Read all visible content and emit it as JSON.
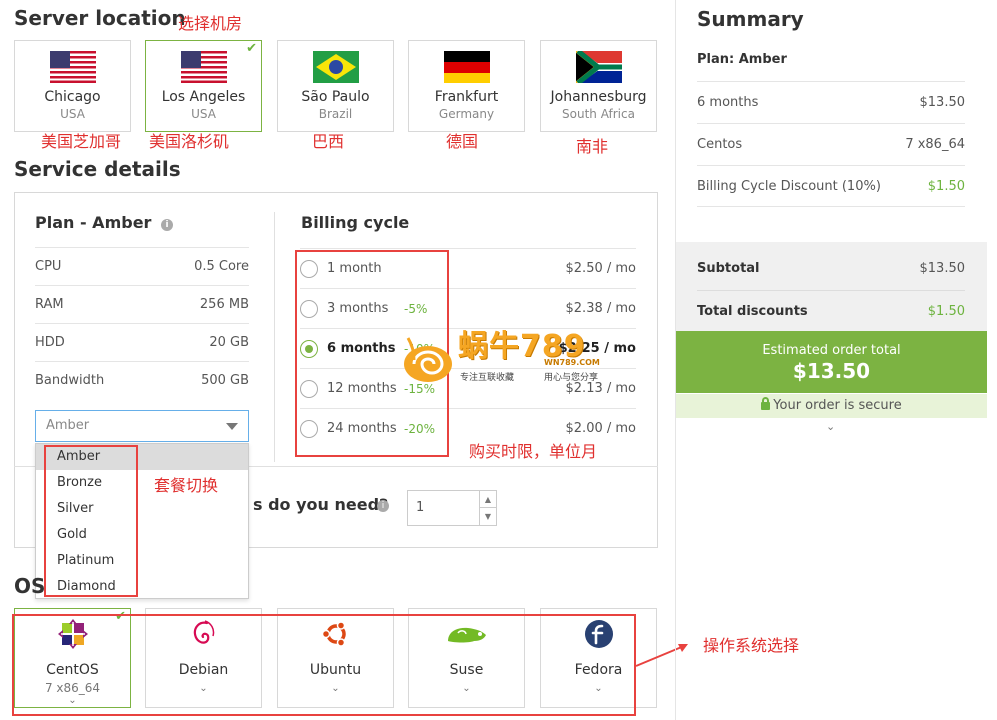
{
  "server_location": {
    "title": "Server location",
    "annotation": "选择机房",
    "locations": [
      {
        "city": "Chicago",
        "country": "USA",
        "flag": "us-flag",
        "note": "美国芝加哥",
        "selected": false
      },
      {
        "city": "Los Angeles",
        "country": "USA",
        "flag": "us-flag",
        "note": "美国洛杉矶",
        "selected": true
      },
      {
        "city": "São Paulo",
        "country": "Brazil",
        "flag": "brazil-flag",
        "note": "巴西",
        "selected": false
      },
      {
        "city": "Frankfurt",
        "country": "Germany",
        "flag": "germany-flag",
        "note": "德国",
        "selected": false
      },
      {
        "city": "Johannesburg",
        "country": "South Africa",
        "flag": "south-africa-flag",
        "note": "南非",
        "selected": false
      }
    ]
  },
  "service_details": {
    "title": "Service details",
    "plan_title": "Plan - Amber",
    "specs": [
      {
        "label": "CPU",
        "value": "0.5 Core"
      },
      {
        "label": "RAM",
        "value": "256 MB"
      },
      {
        "label": "HDD",
        "value": "20 GB"
      },
      {
        "label": "Bandwidth",
        "value": "500 GB"
      }
    ],
    "plan_select_value": "Amber",
    "plan_options": [
      "Amber",
      "Bronze",
      "Silver",
      "Gold",
      "Platinum",
      "Diamond"
    ],
    "plan_annotation": "套餐切换",
    "billing_title": "Billing cycle",
    "billing": [
      {
        "label": "1 month",
        "discount": "",
        "price": "$2.50 / mo",
        "selected": false
      },
      {
        "label": "3 months",
        "discount": "-5%",
        "price": "$2.38 / mo",
        "selected": false
      },
      {
        "label": "6 months",
        "discount": "-10%",
        "price": "$2.25 / mo",
        "selected": true
      },
      {
        "label": "12 months",
        "discount": "-15%",
        "price": "$2.13 / mo",
        "selected": false
      },
      {
        "label": "24 months",
        "discount": "-20%",
        "price": "$2.00 / mo",
        "selected": false
      }
    ],
    "billing_annotation": "购买时限，单位月",
    "quantity_question": "s do you need?",
    "quantity_value": "1"
  },
  "os": {
    "title": "OS",
    "annotation": "操作系统选择",
    "items": [
      {
        "name": "CentOS",
        "version": "7 x86_64",
        "icon": "centos-icon",
        "selected": true
      },
      {
        "name": "Debian",
        "version": "",
        "icon": "debian-icon",
        "selected": false
      },
      {
        "name": "Ubuntu",
        "version": "",
        "icon": "ubuntu-icon",
        "selected": false
      },
      {
        "name": "Suse",
        "version": "",
        "icon": "suse-icon",
        "selected": false
      },
      {
        "name": "Fedora",
        "version": "",
        "icon": "fedora-icon",
        "selected": false
      }
    ]
  },
  "summary": {
    "title": "Summary",
    "plan": "Plan: Amber",
    "rows": [
      {
        "label": "6 months",
        "value": "$13.50"
      },
      {
        "label": "Centos",
        "value": "7 x86_64"
      },
      {
        "label": "Billing Cycle Discount (10%)",
        "value": "$1.50"
      }
    ],
    "subtotal_label": "Subtotal",
    "subtotal_value": "$13.50",
    "discounts_label": "Total discounts",
    "discounts_value": "$1.50",
    "estimated_label": "Estimated order total",
    "estimated_value": "$13.50",
    "secure_text": "Your order is secure"
  },
  "watermark": {
    "brand": "蜗牛789",
    "domain": "WN789.COM",
    "slogan_left": "专注互联收藏",
    "slogan_right": "用心与您分享"
  },
  "colors": {
    "accent_green": "#7cb342",
    "annotation_red": "#e0302f"
  }
}
